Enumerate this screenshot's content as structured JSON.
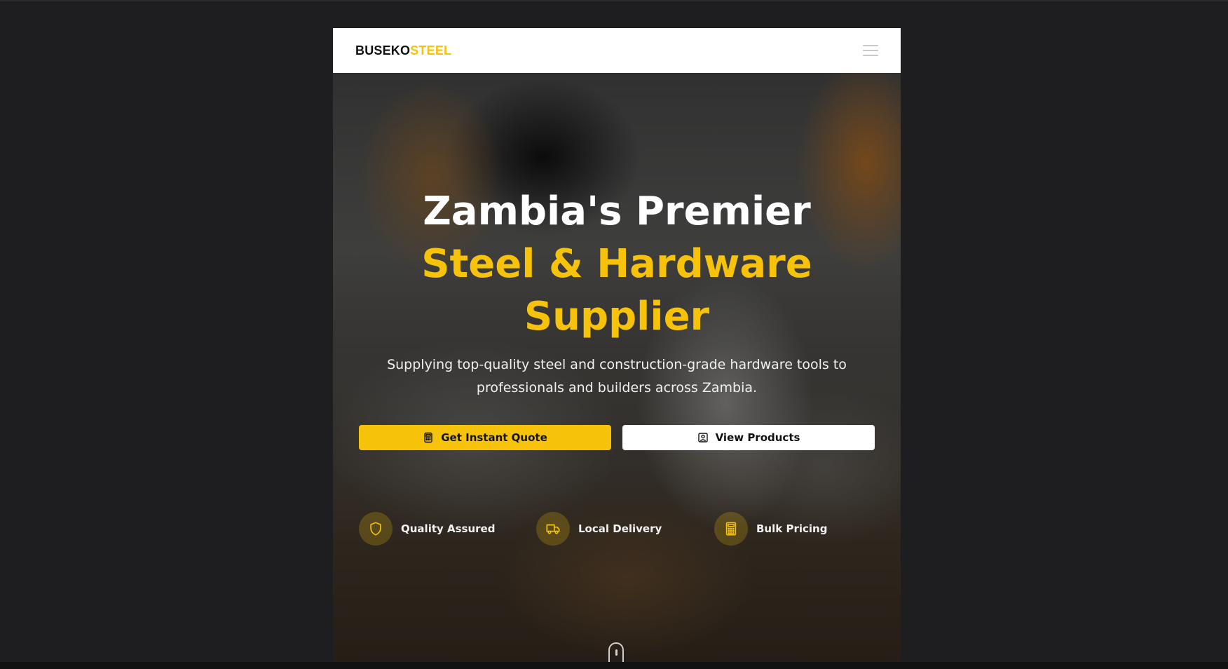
{
  "brand": {
    "part1": "BUSEKO",
    "part2": "STEEL",
    "accent_color": "#f6c20a"
  },
  "nav": {
    "menu_icon": "hamburger-menu-icon"
  },
  "hero": {
    "title_line1": "Zambia's Premier",
    "title_line2": "Steel & Hardware",
    "title_line3": "Supplier",
    "subtitle": "Supplying top-quality steel and construction-grade hardware tools to professionals and builders across Zambia.",
    "buttons": {
      "primary": {
        "label": "Get Instant Quote",
        "icon": "calculator-icon"
      },
      "secondary": {
        "label": "View Products",
        "icon": "image-box-icon"
      }
    },
    "features": [
      {
        "label": "Quality Assured",
        "icon": "shield-icon"
      },
      {
        "label": "Local Delivery",
        "icon": "truck-icon"
      },
      {
        "label": "Bulk Pricing",
        "icon": "calculator-icon"
      }
    ],
    "scroll_indicator_icon": "mouse-scroll-icon"
  }
}
